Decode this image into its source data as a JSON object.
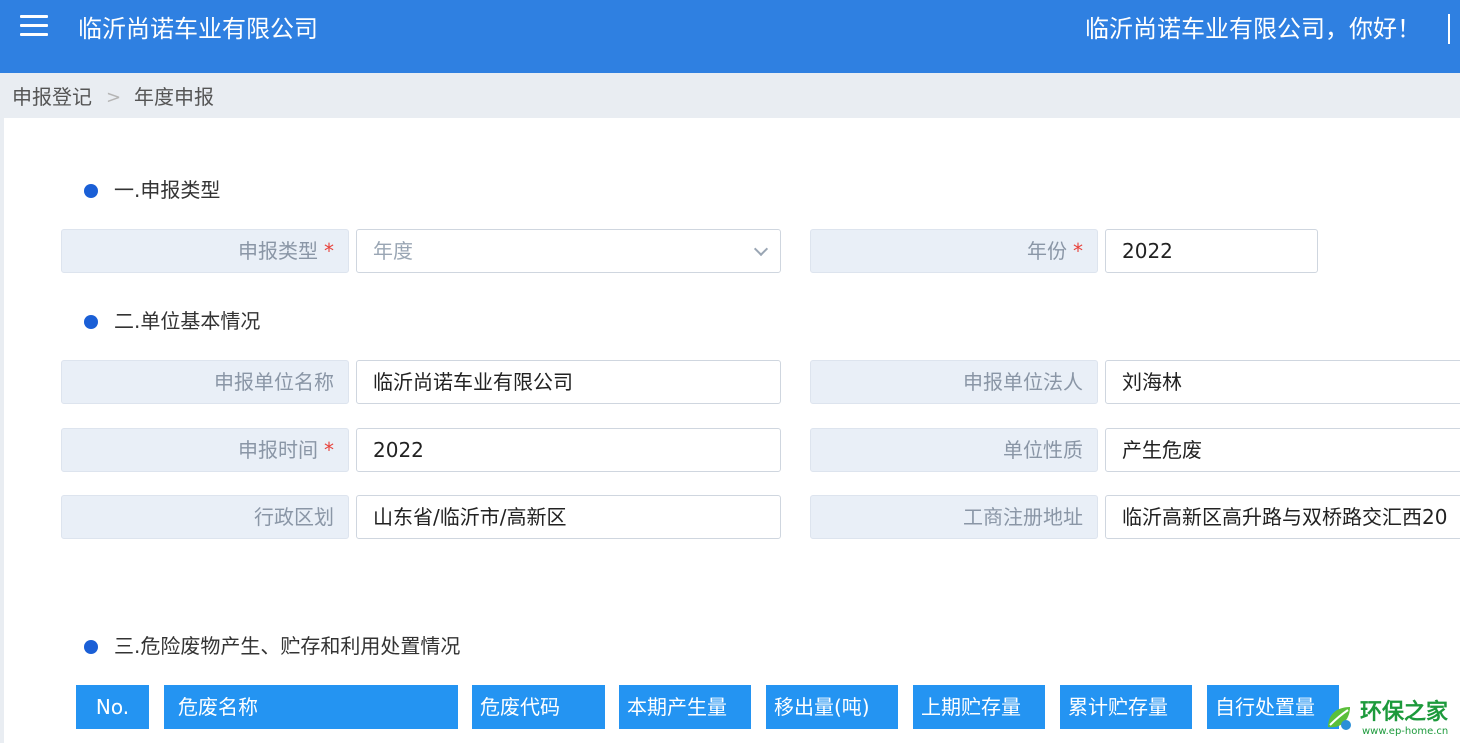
{
  "header": {
    "title": "临沂尚诺车业有限公司",
    "greeting": "临沂尚诺车业有限公司，你好！"
  },
  "breadcrumb": {
    "items": [
      "申报登记",
      "年度申报"
    ],
    "separator": ">"
  },
  "sections": {
    "type": {
      "title": "一.申报类型"
    },
    "basic": {
      "title": "二.单位基本情况"
    },
    "waste": {
      "title": "三.危险废物产生、贮存和利用处置情况"
    }
  },
  "form": {
    "required_mark": "*",
    "report_type": {
      "label": "申报类型",
      "value": "年度",
      "required": true
    },
    "year": {
      "label": "年份",
      "value": "2022",
      "required": true
    },
    "unit_name": {
      "label": "申报单位名称",
      "value": "临沂尚诺车业有限公司"
    },
    "legal_person": {
      "label": "申报单位法人",
      "value": "刘海林"
    },
    "report_time": {
      "label": "申报时间",
      "value": "2022",
      "required": true
    },
    "unit_nature": {
      "label": "单位性质",
      "value": "产生危废"
    },
    "region": {
      "label": "行政区划",
      "value": "山东省/临沂市/高新区"
    },
    "address": {
      "label": "工商注册地址",
      "value": "临沂高新区高升路与双桥路交汇西20"
    }
  },
  "table": {
    "columns": [
      "No.",
      "危废名称",
      "危废代码",
      "本期产生量",
      "移出量(吨)",
      "上期贮存量",
      "累计贮存量",
      "自行处置量"
    ]
  },
  "watermark": {
    "name": "环保之家",
    "url": "www.ep-home.cn"
  },
  "colors": {
    "header_bg": "#2f80e1",
    "table_header_bg": "#2494f2",
    "section_dot": "#1a5fd6",
    "required": "#e8423b"
  },
  "icons": [
    "menu-icon",
    "chevron-right-icon",
    "chevron-down-icon",
    "section-dot-icon",
    "leaf-logo-icon"
  ]
}
